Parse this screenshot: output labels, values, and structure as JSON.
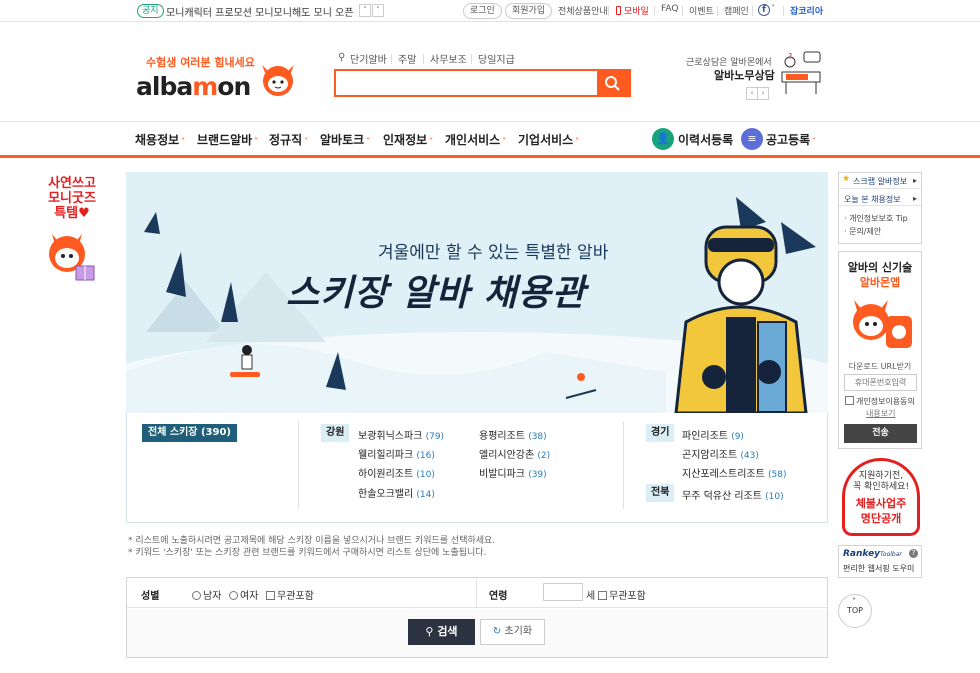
{
  "topbar": {
    "notice_badge": "공지",
    "notice_text": "모니캐릭터 프로모션 모니모니해도 모니 오픈",
    "login": "로그인",
    "signup": "회원가입",
    "all_products": "전체상품안내",
    "mobile": "모바일",
    "faq": "FAQ",
    "event": "이벤트",
    "campaign": "캠페인",
    "jobkorea": "잡코리아"
  },
  "header": {
    "slogan": "수험생 여러분 힘내세요",
    "logo": "albamon",
    "quick_links": [
      "단기알바",
      "주말",
      "사무보조",
      "당일지급"
    ],
    "search_placeholder": "",
    "consult_small": "근로상담은 알바몬에서",
    "consult_big": "알바노무상담"
  },
  "nav": {
    "items": [
      "채용정보",
      "브랜드알바",
      "정규직",
      "알바토크",
      "인재정보",
      "개인서비스",
      "기업서비스"
    ],
    "resume": "이력서등록",
    "post_job": "공고등록"
  },
  "left_ad": {
    "title": "사연쓰고 모니굿즈 특템♥"
  },
  "banner": {
    "subtitle": "겨울에만 할 수 있는 특별한 알바",
    "title": "스키장 알바 채용관"
  },
  "resorts": {
    "all_label": "전체 스키장 (390)",
    "gangwon_label": "강원",
    "gangwon": [
      {
        "name": "보광휘닉스파크",
        "count": "(79)"
      },
      {
        "name": "웰리힐리파크",
        "count": "(16)"
      },
      {
        "name": "하이원리조트",
        "count": "(10)"
      },
      {
        "name": "한솔오크밸리",
        "count": "(14)"
      },
      {
        "name": "용평리조트",
        "count": "(38)"
      },
      {
        "name": "엘리시안강촌",
        "count": "(2)"
      },
      {
        "name": "비발디파크",
        "count": "(39)"
      }
    ],
    "gyeonggi_label": "경기",
    "gyeonggi": [
      {
        "name": "파인리조트",
        "count": "(9)"
      },
      {
        "name": "곤지암리조트",
        "count": "(43)"
      },
      {
        "name": "지산포레스트리조트",
        "count": "(58)"
      }
    ],
    "jeonbuk_label": "전북",
    "jeonbuk": [
      {
        "name": "무주 덕유산 리조트",
        "count": "(10)"
      }
    ]
  },
  "notes": [
    "* 리스트에 노출하시려면 공고제목에 해당 스키장 이름을 넣으시거나 브랜드 키워드를 선택하세요.",
    "* 키워드 '스키장' 또는 스키장 관련 브랜드를 키워드에서 구매하시면 리스트 상단에 노출됩니다."
  ],
  "filter": {
    "gender_label": "성별",
    "male": "남자",
    "female": "여자",
    "any": "무관포함",
    "age_label": "연령",
    "age_unit": "세",
    "age_any": "무관포함",
    "search": "검색",
    "reset": "초기화"
  },
  "sidebar": {
    "scrap": "스크랩 알바정보",
    "today": "오늘 본 채용정보",
    "privacy": "· 개인정보보호 Tip",
    "inquiry": "· 문의/제안",
    "app_title_1": "알바의 신기술",
    "app_title_2": "알바몬앱",
    "download": "다운로드 URL받기",
    "phone_placeholder": "휴대폰번호입력",
    "consent": "개인정보이용동의",
    "consent_view": "내용보기",
    "send": "전송",
    "ad_line1": "지원하기전,",
    "ad_line2": "꼭 확인하세요!",
    "ad_line3": "체불사업주",
    "ad_line4": "명단공개",
    "rankey": "Rankey",
    "rankey_toolbar": "Toolbar",
    "rankey_desc": "편리한 웹서핑 도우미",
    "top": "TOP"
  },
  "colors": {
    "brand": "#ff5a1f",
    "banner_bg": "#dff0f6",
    "dark": "#2c3340"
  }
}
